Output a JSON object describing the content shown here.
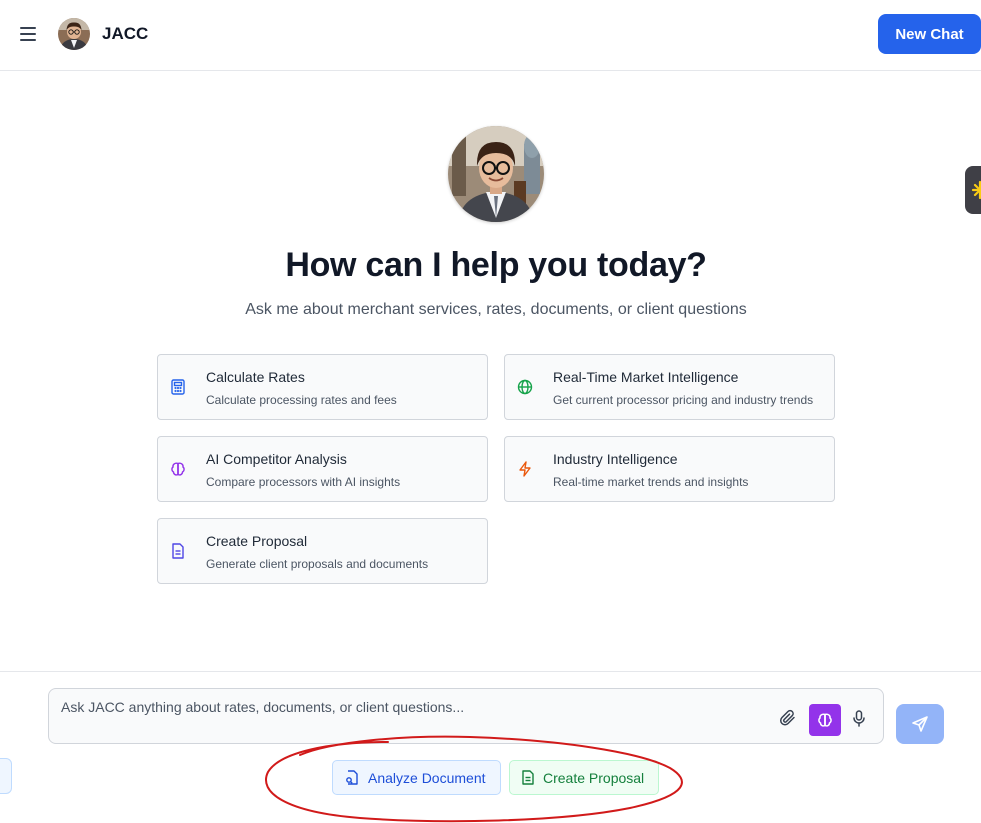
{
  "header": {
    "brand": "JACC",
    "new_chat_label": "New Chat"
  },
  "hero": {
    "title": "How can I help you today?",
    "subtitle": "Ask me about merchant services, rates, documents, or client questions"
  },
  "actions": [
    {
      "title": "Calculate Rates",
      "description": "Calculate processing rates and fees",
      "icon": "calculator-icon",
      "color": "#2563eb"
    },
    {
      "title": "Real-Time Market Intelligence",
      "description": "Get current processor pricing and industry trends",
      "icon": "globe-icon",
      "color": "#16a34a"
    },
    {
      "title": "AI Competitor Analysis",
      "description": "Compare processors with AI insights",
      "icon": "brain-icon",
      "color": "#9333ea"
    },
    {
      "title": "Industry Intelligence",
      "description": "Real-time market trends and insights",
      "icon": "lightning-icon",
      "color": "#ea580c"
    },
    {
      "title": "Create Proposal",
      "description": "Generate client proposals and documents",
      "icon": "document-icon",
      "color": "#4f46e5"
    }
  ],
  "composer": {
    "placeholder": "Ask JACC anything about rates, documents, or client questions..."
  },
  "quick_actions": {
    "analyze_label": "Analyze Document",
    "proposal_label": "Create Proposal"
  },
  "colors": {
    "primary": "#2563eb",
    "brain_accent": "#9333ea",
    "annotation": "#d11a1a"
  }
}
